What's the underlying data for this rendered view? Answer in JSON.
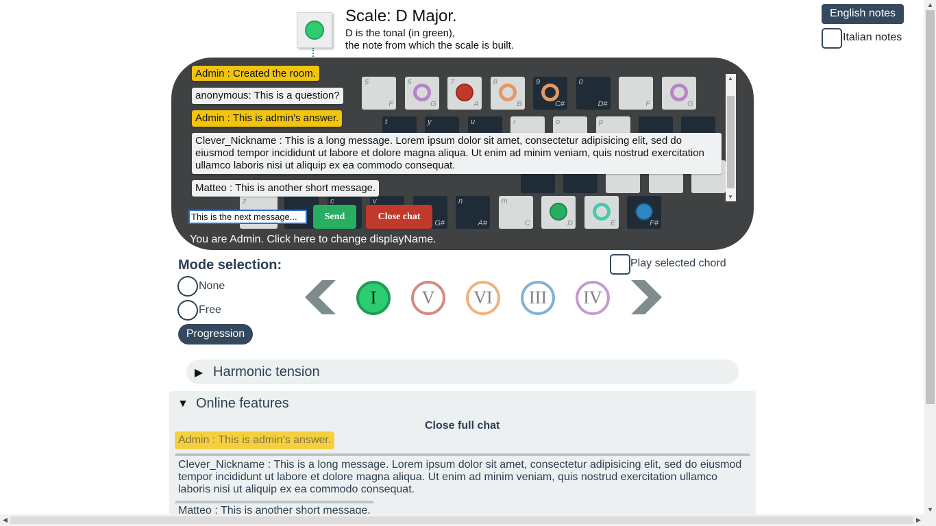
{
  "header": {
    "scale_title": "Scale: D Major.",
    "desc_line1": "D is the tonal (in green),",
    "desc_line2": "the note from which the scale is built.",
    "tonal_color": "#2ecc71"
  },
  "notation": {
    "english_label": "English notes",
    "italian_label": "Italian notes"
  },
  "keyboard": {
    "row1": [
      {
        "letter": "5",
        "note": "F",
        "shade": "light",
        "circle": ""
      },
      {
        "letter": "6",
        "note": "G",
        "shade": "light",
        "circle": "ring-violet"
      },
      {
        "letter": "7",
        "note": "A",
        "shade": "light",
        "circle": "fill-red"
      },
      {
        "letter": "8",
        "note": "B",
        "shade": "light",
        "circle": "ring-orange"
      },
      {
        "letter": "9",
        "note": "C#",
        "shade": "dark",
        "circle": "ring-orange"
      },
      {
        "letter": "0",
        "note": "D#",
        "shade": "dark",
        "circle": ""
      },
      {
        "letter": "",
        "note": "F",
        "shade": "light",
        "circle": ""
      },
      {
        "letter": "",
        "note": "G",
        "shade": "light",
        "circle": "ring-violet"
      }
    ],
    "row3": [
      {
        "letter": "n",
        "note": "A#",
        "shade": "dark",
        "circle": ""
      },
      {
        "letter": "m",
        "note": "C",
        "shade": "light",
        "circle": ""
      },
      {
        "letter": "",
        "note": "D",
        "shade": "light",
        "circle": "fill-green"
      },
      {
        "letter": "",
        "note": "E",
        "shade": "light",
        "circle": "ring-teal"
      },
      {
        "letter": "",
        "note": "F#",
        "shade": "dark",
        "circle": "fill-blue"
      }
    ]
  },
  "chat": {
    "messages": [
      {
        "text": "Admin : Created the room.",
        "admin": true
      },
      {
        "text": "anonymous: This is a question?",
        "admin": false
      },
      {
        "text": "Admin : This is admin's answer.",
        "admin": true
      },
      {
        "text": "Clever_Nickname : This is a long message. Lorem ipsum dolor sit amet, consectetur adipisicing elit, sed do eiusmod tempor incididunt ut labore et dolore magna aliqua. Ut enim ad minim veniam, quis nostrud exercitation ullamco laboris nisi ut aliquip ex ea commodo consequat.",
        "admin": false
      },
      {
        "text": "Matteo : This is another short message.",
        "admin": false
      }
    ],
    "input_value": "This is the next message...",
    "send_label": "Send",
    "close_label": "Close chat",
    "identity_text": "You are Admin. Click here to change displayName."
  },
  "mode": {
    "title": "Mode selection:",
    "options": [
      "None",
      "Free"
    ],
    "progression_label": "Progression",
    "play_chord_label": "Play selected chord"
  },
  "progression": {
    "degrees": [
      {
        "label": "I",
        "color": "#1e9c55",
        "fill": "#2ecc71",
        "text_color": "#111111"
      },
      {
        "label": "V",
        "color": "#d98880",
        "fill": "#ffffff",
        "text_color": "#808080"
      },
      {
        "label": "VI",
        "color": "#f0b27a",
        "fill": "#ffffff",
        "text_color": "#808080"
      },
      {
        "label": "III",
        "color": "#7fb3d5",
        "fill": "#ffffff",
        "text_color": "#808080"
      },
      {
        "label": "IV",
        "color": "#c39bd3",
        "fill": "#ffffff",
        "text_color": "#808080"
      }
    ]
  },
  "sections": {
    "harmonic": "Harmonic tension",
    "online": "Online features",
    "close_full_chat": "Close full chat"
  },
  "full_chat": [
    {
      "text": "Admin : This is admin's answer.",
      "admin": true
    },
    {
      "text": "Clever_Nickname : This is a long message. Lorem ipsum dolor sit amet, consectetur adipisicing elit, sed do eiusmod tempor incididunt ut labore et dolore magna aliqua. Ut enim ad minim veniam, quis nostrud exercitation ullamco laboris nisi ut aliquip ex ea commodo consequat.",
      "admin": false
    },
    {
      "text": "Matteo : This is another short message.",
      "admin": false
    }
  ]
}
